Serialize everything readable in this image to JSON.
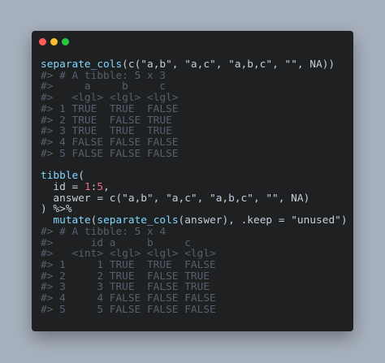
{
  "colors": {
    "background": "#a7b1bd",
    "window": "#1f2022",
    "dot_red": "#ff5f57",
    "dot_yellow": "#febc2e",
    "dot_green": "#28c840",
    "function": "#7fd6ff",
    "number": "#f46a86",
    "comment": "#55606e",
    "text": "#c5cedb"
  },
  "code": {
    "line1": {
      "fn": "separate_cols",
      "rest": "(c(\"a,b\", \"a,c\", \"a,b,c\", \"\", NA))"
    },
    "output1": [
      "#> # A tibble: 5 x 3",
      "#>     a     b     c",
      "#>   <lgl> <lgl> <lgl>",
      "#> 1 TRUE  TRUE  FALSE",
      "#> 2 TRUE  FALSE TRUE",
      "#> 3 TRUE  TRUE  TRUE",
      "#> 4 FALSE FALSE FALSE",
      "#> 5 FALSE FALSE FALSE"
    ],
    "tibble": {
      "fn": "tibble",
      "open": "(",
      "id_indent": "  id = ",
      "id_from": "1",
      "id_colon": ":",
      "id_to": "5",
      "id_comma": ",",
      "answer_line": "  answer = c(\"a,b\", \"a,c\", \"a,b,c\", \"\", NA)",
      "close_pipe": ") %>%",
      "mutate_indent": "  ",
      "mutate_fn": "mutate",
      "mutate_open": "(",
      "sep_fn": "separate_cols",
      "mutate_rest": "(answer), .keep = \"unused\")"
    },
    "output2": [
      "#> # A tibble: 5 x 4",
      "#>      id a     b     c",
      "#>   <int> <lgl> <lgl> <lgl>",
      "#> 1     1 TRUE  TRUE  FALSE",
      "#> 2     2 TRUE  FALSE TRUE",
      "#> 3     3 TRUE  FALSE TRUE",
      "#> 4     4 FALSE FALSE FALSE",
      "#> 5     5 FALSE FALSE FALSE"
    ]
  }
}
